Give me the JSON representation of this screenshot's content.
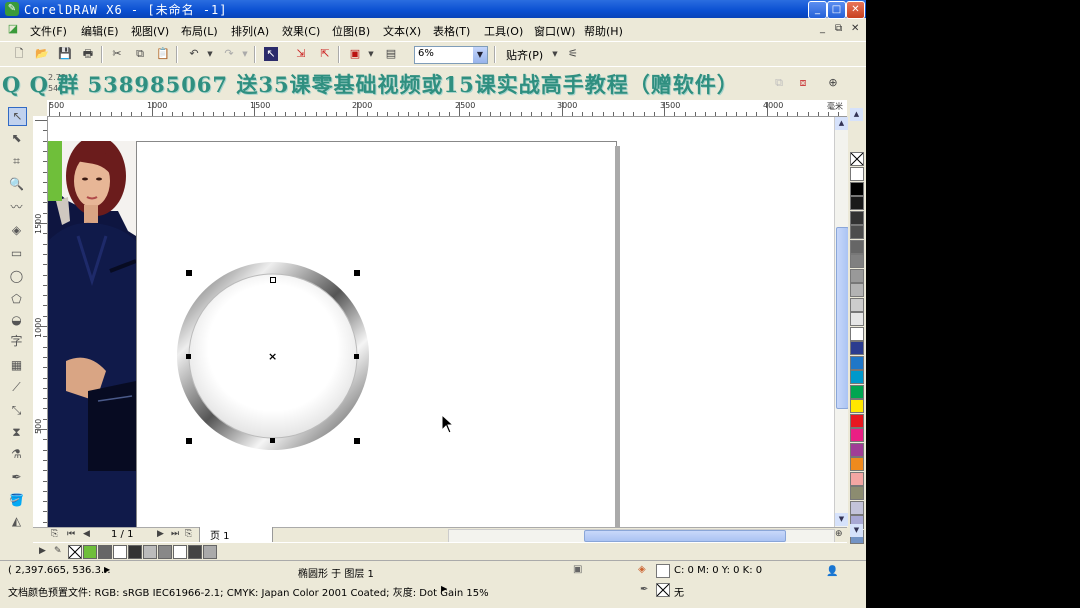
{
  "window": {
    "title": "CorelDRAW X6 - [未命名 -1]",
    "minimize": "_",
    "maximize": "□",
    "close": "✕"
  },
  "menu": [
    "文件(F)",
    "编辑(E)",
    "视图(V)",
    "布局(L)",
    "排列(A)",
    "效果(C)",
    "位图(B)",
    "文本(X)",
    "表格(T)",
    "工具(O)",
    "窗口(W)",
    "帮助(H)"
  ],
  "mdi_buttons": [
    "_",
    "⧉",
    "✕"
  ],
  "toolbar": {
    "zoom_value": "6%",
    "snap_label": "贴齐(P)"
  },
  "watermark_text": "Q Q 群 538985067 送35课零基础视频或15课实战高手教程（赠软件）",
  "property_bar": {
    "x_value": "2.78",
    "y_value": "543"
  },
  "ruler_h_labels": [
    "500",
    "1000",
    "1500",
    "2000",
    "2500",
    "3000",
    "3500",
    "4000",
    "毫米"
  ],
  "ruler_v_labels": [
    "1500",
    "1000",
    "500"
  ],
  "toolbox_icons": [
    "pick-tool",
    "shape-tool",
    "crop-tool",
    "zoom-tool",
    "freehand-tool",
    "smart-fill-tool",
    "rectangle-tool",
    "ellipse-tool",
    "polygon-tool",
    "basic-shapes-tool",
    "text-tool",
    "table-tool",
    "dimension-tool",
    "connector-tool",
    "blend-tool",
    "eyedropper-tool",
    "outline-tool",
    "fill-tool",
    "interactive-fill-tool"
  ],
  "document": {
    "page_count": "1 / 1",
    "page_tab": "页 1"
  },
  "color_palette": [
    "#ffffff",
    "#000000",
    "#1a1a1a",
    "#333333",
    "#4d4d4d",
    "#666666",
    "#808080",
    "#999999",
    "#b3b3b3",
    "#cccccc",
    "#e6e6e6",
    "#ffffff",
    "#2b3c8f",
    "#1f77c8",
    "#0099cc",
    "#00a651",
    "#ffe600",
    "#e8171f",
    "#ea1f84",
    "#a03d96",
    "#ef8a1e",
    "#f4a6a3",
    "#8c8c70",
    "#c3c3d9",
    "#a8a8d4",
    "#7393c4"
  ],
  "doc_color_swatches": [
    "#6fbf3a",
    "#666666",
    "#ffffff",
    "#333333",
    "#bbbbbb",
    "#888888",
    "#ffffff",
    "#444444",
    "#aaaaaa"
  ],
  "status": {
    "coordinates": "( 2,397.665, 536.3...",
    "object_info": "椭圆形 于 图层 1",
    "fill_info": "C: 0 M: 0 Y: 0 K: 0",
    "outline_info": "无",
    "color_profile": "文档颜色预置文件: RGB: sRGB IEC61966-2.1; CMYK: Japan Color 2001 Coated; 灰度: Dot Gain 15%"
  }
}
